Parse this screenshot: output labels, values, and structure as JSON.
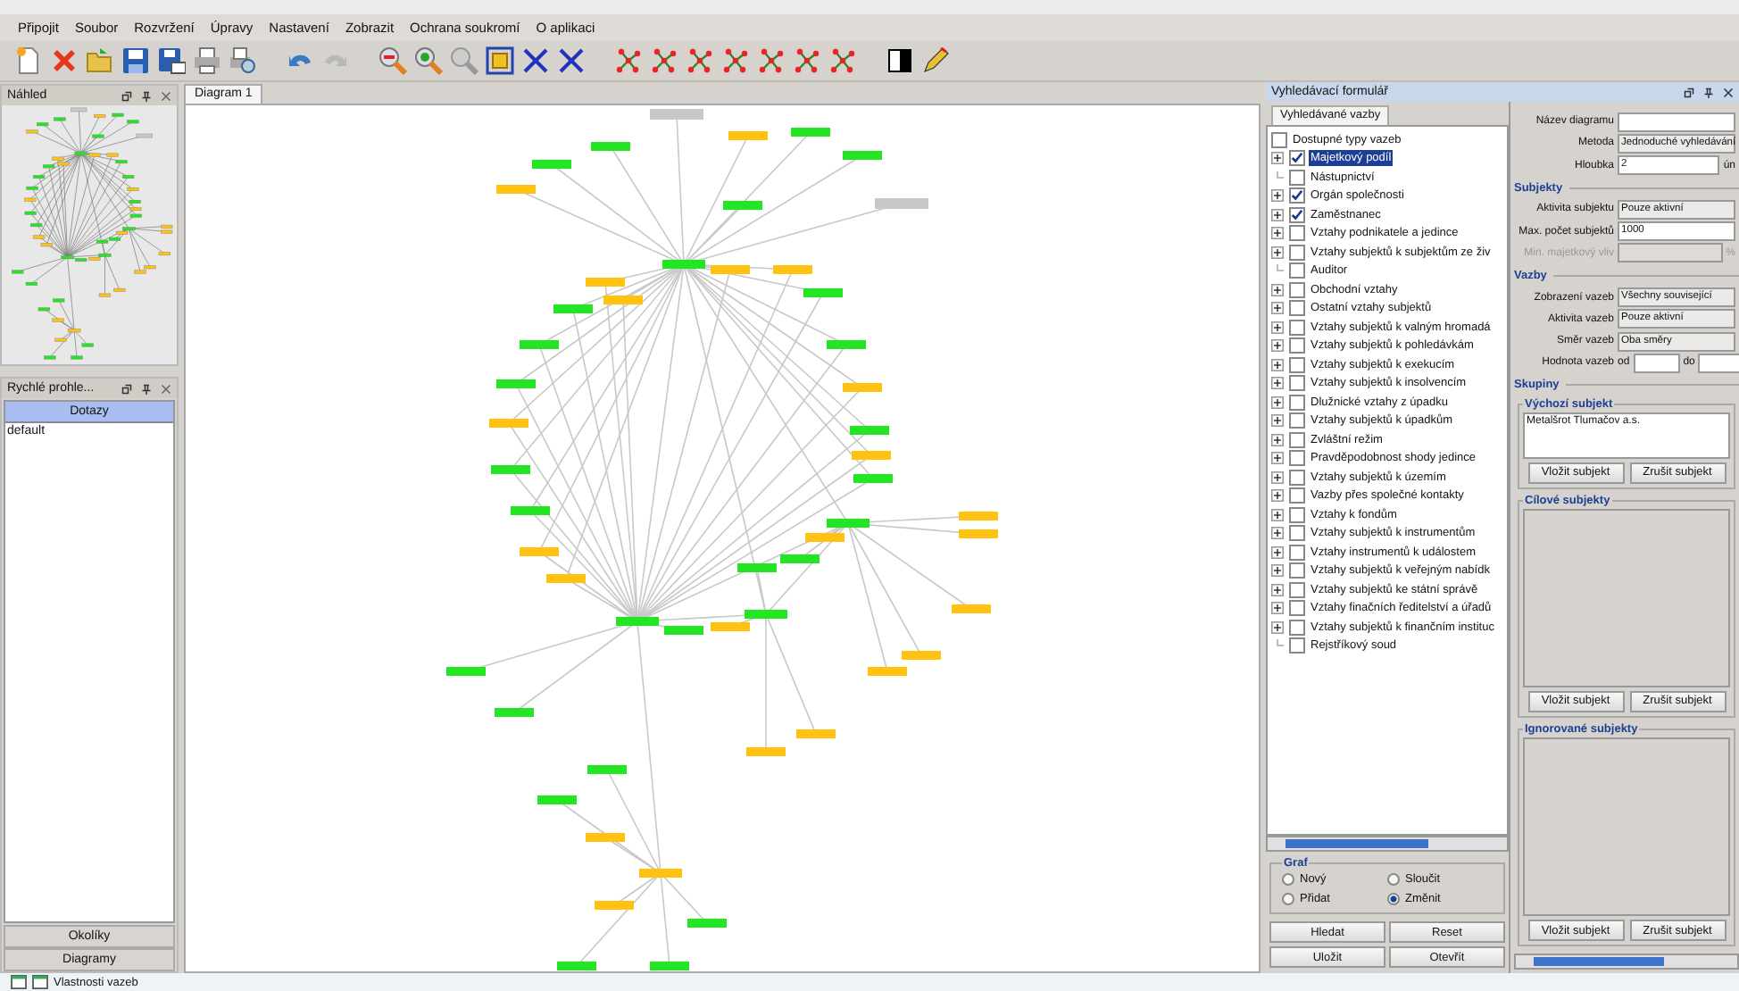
{
  "menu": [
    "Připojit",
    "Soubor",
    "Rozvržení",
    "Úpravy",
    "Nastavení",
    "Zobrazit",
    "Ochrana soukromí",
    "O aplikaci"
  ],
  "preview": {
    "title": "Náhled"
  },
  "queries": {
    "title": "Rychlé prohle...",
    "header": "Dotazy",
    "items": [
      "default"
    ],
    "bottom_tabs": [
      "Okolíky",
      "Diagramy"
    ]
  },
  "diagram": {
    "tab": "Diagram 1"
  },
  "search_panel": {
    "title": "Vyhledávací formulář",
    "tab": "Vyhledávané vazby",
    "root": {
      "label": "Dostupné typy vazeb",
      "checked": false
    },
    "items": [
      {
        "label": "Majetkový podíl",
        "checked": true,
        "expandable": true,
        "selected": true
      },
      {
        "label": "Nástupnictví",
        "checked": false,
        "expandable": false,
        "selected": false
      },
      {
        "label": "Orgán společnosti",
        "checked": true,
        "expandable": true,
        "selected": false
      },
      {
        "label": "Zaměstnanec",
        "checked": true,
        "expandable": true,
        "selected": false
      },
      {
        "label": "Vztahy podnikatele a jedince",
        "checked": false,
        "expandable": true,
        "selected": false
      },
      {
        "label": "Vztahy subjektů k subjektům ze živ",
        "checked": false,
        "expandable": true,
        "selected": false
      },
      {
        "label": "Auditor",
        "checked": false,
        "expandable": false,
        "selected": false
      },
      {
        "label": "Obchodní vztahy",
        "checked": false,
        "expandable": true,
        "selected": false
      },
      {
        "label": "Ostatní vztahy subjektů",
        "checked": false,
        "expandable": true,
        "selected": false
      },
      {
        "label": "Vztahy subjektů k valným hromadá",
        "checked": false,
        "expandable": true,
        "selected": false
      },
      {
        "label": "Vztahy subjektů k pohledávkám",
        "checked": false,
        "expandable": true,
        "selected": false
      },
      {
        "label": "Vztahy subjektů k exekucím",
        "checked": false,
        "expandable": true,
        "selected": false
      },
      {
        "label": "Vztahy subjektů k insolvencím",
        "checked": false,
        "expandable": true,
        "selected": false
      },
      {
        "label": "Dlužnické vztahy z úpadku",
        "checked": false,
        "expandable": true,
        "selected": false
      },
      {
        "label": "Vztahy subjektů k úpadkům",
        "checked": false,
        "expandable": true,
        "selected": false
      },
      {
        "label": "Zvláštní režim",
        "checked": false,
        "expandable": true,
        "selected": false
      },
      {
        "label": "Pravděpodobnost shody jedince",
        "checked": false,
        "expandable": true,
        "selected": false
      },
      {
        "label": "Vztahy subjektů k územím",
        "checked": false,
        "expandable": true,
        "selected": false
      },
      {
        "label": "Vazby přes společné kontakty",
        "checked": false,
        "expandable": true,
        "selected": false
      },
      {
        "label": "Vztahy k fondům",
        "checked": false,
        "expandable": true,
        "selected": false
      },
      {
        "label": "Vztahy subjektů k instrumentům",
        "checked": false,
        "expandable": true,
        "selected": false
      },
      {
        "label": "Vztahy instrumentů k událostem",
        "checked": false,
        "expandable": true,
        "selected": false
      },
      {
        "label": "Vztahy subjektů k veřejným nabídk",
        "checked": false,
        "expandable": true,
        "selected": false
      },
      {
        "label": "Vztahy subjektů ke státní správě",
        "checked": false,
        "expandable": true,
        "selected": false
      },
      {
        "label": "Vztahy finačních ředitelství a úřadů",
        "checked": false,
        "expandable": true,
        "selected": false
      },
      {
        "label": "Vztahy subjektů k finančním instituc",
        "checked": false,
        "expandable": true,
        "selected": false
      },
      {
        "label": "Rejstříkový soud",
        "checked": false,
        "expandable": false,
        "selected": false
      }
    ]
  },
  "graph_mode": {
    "title": "Graf",
    "options": [
      {
        "label": "Nový",
        "selected": false
      },
      {
        "label": "Sloučit",
        "selected": false
      },
      {
        "label": "Přidat",
        "selected": false
      },
      {
        "label": "Změnit",
        "selected": true
      }
    ]
  },
  "actions": [
    "Hledat",
    "Reset",
    "Uložit",
    "Otevřít"
  ],
  "form": {
    "rows": [
      {
        "kind": "text",
        "label": "Název diagramu",
        "disabled": false
      },
      {
        "kind": "select",
        "label": "Metoda",
        "value": "Jednoduché vyhledávání"
      },
      {
        "kind": "text",
        "label": "Hloubka",
        "value": "2",
        "suffix": "ún",
        "disabled": false
      },
      {
        "kind": "heading",
        "label": "Subjekty"
      },
      {
        "kind": "select",
        "label": "Aktivita subjektu",
        "value": "Pouze aktivní"
      },
      {
        "kind": "text",
        "label": "Max. počet subjektů",
        "value": "1000",
        "disabled": false
      },
      {
        "kind": "text",
        "label": "Min. majetkový vliv",
        "suffix": "%",
        "disabled": true
      },
      {
        "kind": "heading",
        "label": "Vazby"
      },
      {
        "kind": "select",
        "label": "Zobrazení vazeb",
        "value": "Všechny související"
      },
      {
        "kind": "select",
        "label": "Aktivita vazeb",
        "value": "Pouze aktivní"
      },
      {
        "kind": "select",
        "label": "Směr vazeb",
        "value": "Oba směry"
      },
      {
        "kind": "range",
        "label": "Hodnota vazeb",
        "from": "od",
        "to": "do"
      },
      {
        "kind": "heading",
        "label": "Skupiny"
      }
    ],
    "groups": [
      {
        "title": "Výchozí subjekt",
        "items": [
          "Metalšrot Tlumačov a.s."
        ],
        "buttons": [
          "Vložit subjekt",
          "Zrušit subjekt"
        ]
      },
      {
        "title": "Cílové subjekty",
        "buttons": [
          "Vložit subjekt",
          "Zrušit subjekt"
        ]
      },
      {
        "title": "Ignorované subjekty",
        "buttons": [
          "Vložit subjekt",
          "Zrušit subjekt"
        ]
      }
    ]
  },
  "status_bar": {
    "tab": "Vlastnosti vazeb"
  }
}
